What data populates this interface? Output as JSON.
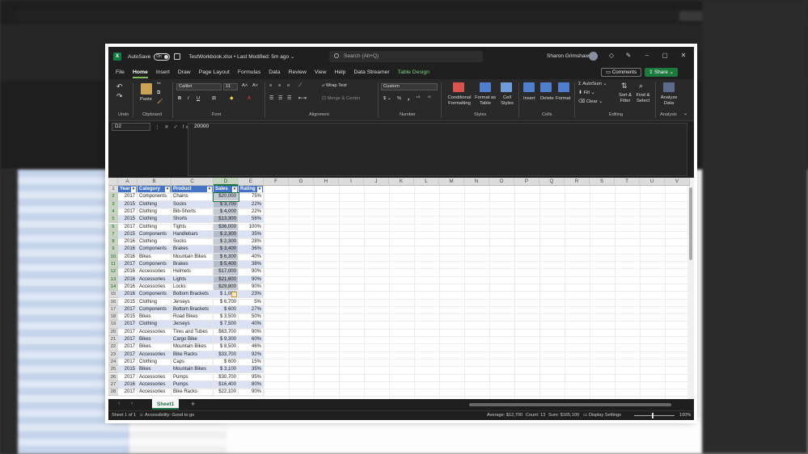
{
  "titlebar": {
    "autosave_label": "AutoSave",
    "autosave_state": "On",
    "doc_title": "TestWorkbook.xlsx • Last Modified: 5m ago ⌄",
    "search_placeholder": "Search (Alt+Q)",
    "user_name": "Sharon Grimshaw"
  },
  "menu": {
    "items": [
      "File",
      "Home",
      "Insert",
      "Draw",
      "Page Layout",
      "Formulas",
      "Data",
      "Review",
      "View",
      "Help",
      "Data Streamer",
      "Table Design"
    ],
    "active": "Home",
    "comments": "Comments",
    "share": "Share"
  },
  "ribbon": {
    "groups": {
      "undo": "Undo",
      "clipboard": "Clipboard",
      "font": "Font",
      "alignment": "Alignment",
      "number": "Number",
      "styles": "Styles",
      "cells": "Cells",
      "editing": "Editing",
      "analysis": "Analysis"
    },
    "paste": "Paste",
    "font_name": "Calibri",
    "font_size": "11",
    "wrap_text": "Wrap Text",
    "merge_center": "Merge & Center",
    "number_format": "Custom",
    "conditional_formatting": "Conditional Formatting",
    "format_as_table": "Format as Table",
    "cell_styles": "Cell Styles",
    "insert": "Insert",
    "delete": "Delete",
    "format": "Format",
    "autosum": "AutoSum",
    "fill": "Fill",
    "clear": "Clear",
    "sort_filter": "Sort & Filter",
    "find_select": "Find & Select",
    "analyze_data": "Analyze Data"
  },
  "formula_bar": {
    "name_box": "D2",
    "value": "20000"
  },
  "columns": [
    "A",
    "B",
    "C",
    "D",
    "E",
    "F",
    "G",
    "H",
    "I",
    "J",
    "K",
    "L",
    "M",
    "N",
    "O",
    "P",
    "Q",
    "R",
    "S",
    "T",
    "U",
    "V"
  ],
  "table": {
    "headers": [
      "Year",
      "Category",
      "Product",
      "Sales",
      "Rating"
    ],
    "rows": [
      [
        "2017",
        "Components",
        "Chains",
        "$20,000",
        "75%"
      ],
      [
        "2015",
        "Clothing",
        "Socks",
        "$  3,700",
        "22%"
      ],
      [
        "2017",
        "Clothing",
        "Bib-Shorts",
        "$  4,000",
        "22%"
      ],
      [
        "2015",
        "Clothing",
        "Shorts",
        "$13,300",
        "56%"
      ],
      [
        "2017",
        "Clothing",
        "Tights",
        "$36,000",
        "100%"
      ],
      [
        "2015",
        "Components",
        "Handlebars",
        "$  2,300",
        "35%"
      ],
      [
        "2016",
        "Clothing",
        "Socks",
        "$  2,300",
        "28%"
      ],
      [
        "2016",
        "Components",
        "Brakes",
        "$  3,400",
        "36%"
      ],
      [
        "2016",
        "Bikes",
        "Mountain Bikes",
        "$  6,300",
        "40%"
      ],
      [
        "2017",
        "Components",
        "Brakes",
        "$  5,400",
        "38%"
      ],
      [
        "2016",
        "Accessories",
        "Helmets",
        "$17,000",
        "90%"
      ],
      [
        "2016",
        "Accessories",
        "Lights",
        "$21,600",
        "90%"
      ],
      [
        "2016",
        "Accessories",
        "Locks",
        "$29,800",
        "90%"
      ],
      [
        "2016",
        "Components",
        "Bottom Brackets",
        "$  1,000",
        "23%"
      ],
      [
        "2015",
        "Clothing",
        "Jerseys",
        "$  6,700",
        "5%"
      ],
      [
        "2017",
        "Components",
        "Bottom Brackets",
        "$     600",
        "27%"
      ],
      [
        "2015",
        "Bikes",
        "Road Bikes",
        "$  3,500",
        "50%"
      ],
      [
        "2017",
        "Clothing",
        "Jerseys",
        "$  7,500",
        "40%"
      ],
      [
        "2017",
        "Accessories",
        "Tires and Tubes",
        "$63,700",
        "90%"
      ],
      [
        "2017",
        "Bikes",
        "Cargo Bike",
        "$  9,300",
        "60%"
      ],
      [
        "2017",
        "Bikes",
        "Mountain Bikes",
        "$  8,500",
        "46%"
      ],
      [
        "2017",
        "Accessories",
        "Bike Racks",
        "$33,700",
        "92%"
      ],
      [
        "2017",
        "Clothing",
        "Caps",
        "$     600",
        "15%"
      ],
      [
        "2015",
        "Bikes",
        "Mountain Bikes",
        "$  3,100",
        "35%"
      ],
      [
        "2017",
        "Accessories",
        "Pumps",
        "$30,700",
        "95%"
      ],
      [
        "2016",
        "Accessories",
        "Pumps",
        "$16,400",
        "80%"
      ],
      [
        "2017",
        "Accessories",
        "Bike Racks",
        "$22,100",
        "90%"
      ]
    ]
  },
  "sheet_tab": "Sheet1",
  "status": {
    "sheet_pos": "Sheet 1 of 1",
    "accessibility": "Accessibility: Good to go",
    "average": "Average: $12,700",
    "count": "Count: 13",
    "sum": "Sum: $165,100",
    "display_settings": "Display Settings",
    "zoom": "100%"
  },
  "colors": {
    "accent_green": "#217346",
    "table_header": "#4472c4",
    "table_band": "#d9e1f2",
    "share_green": "#1d7a3e"
  }
}
